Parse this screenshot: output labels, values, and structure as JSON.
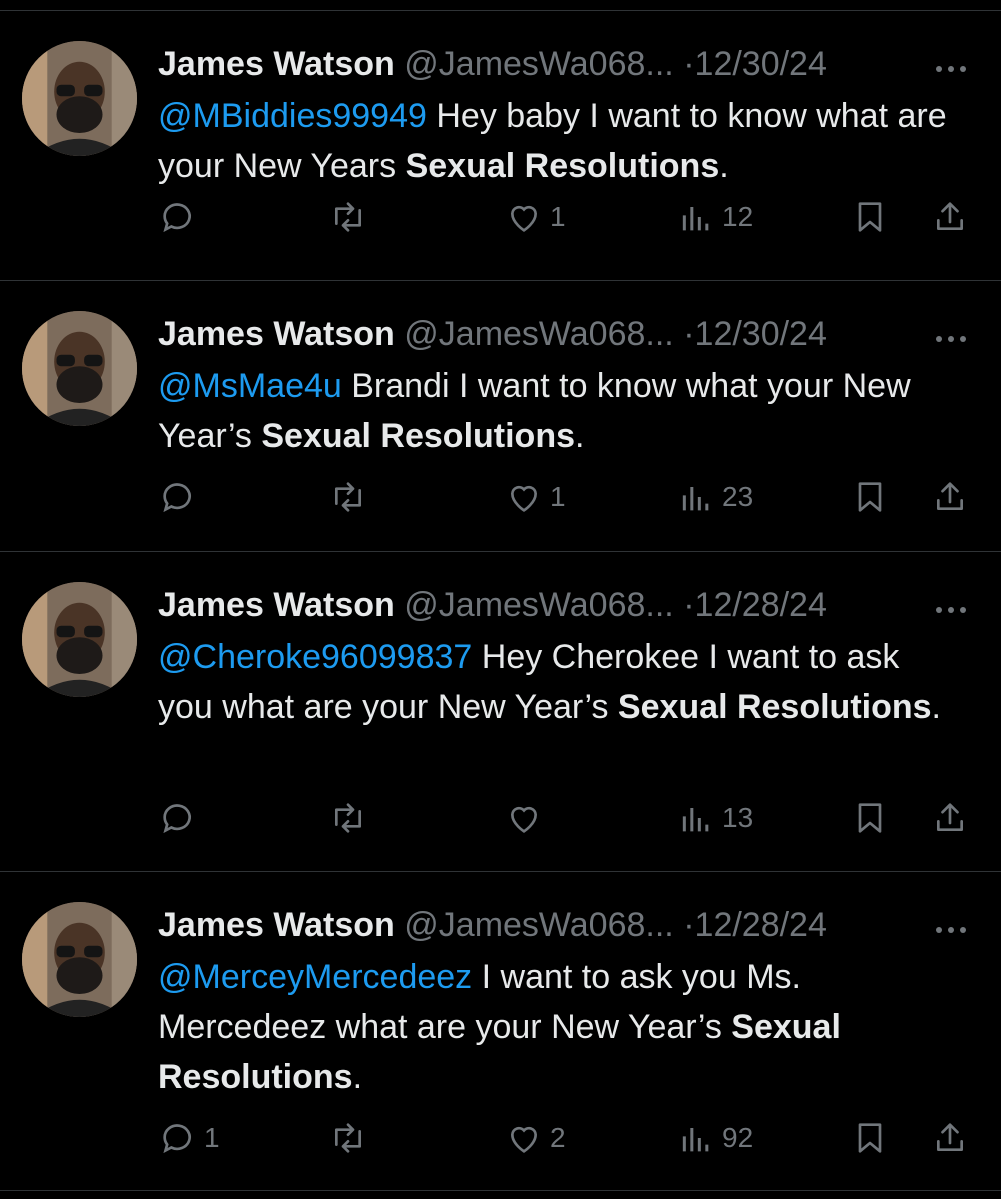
{
  "tweets": [
    {
      "name": "James Watson",
      "handle": "@JamesWa068...",
      "date": "12/30/24",
      "mention": "@MBiddies99949",
      "text_before_bold": " Hey baby I want to know what are your New Years ",
      "bold": "Sexual Resolutions",
      "text_after_bold": ".",
      "replies": "",
      "retweets": "",
      "likes": "1",
      "views": "12"
    },
    {
      "name": "James Watson",
      "handle": "@JamesWa068...",
      "date": "12/30/24",
      "mention": "@MsMae4u",
      "text_before_bold": " Brandi I want to know what your New Year’s ",
      "bold": "Sexual Resolutions",
      "text_after_bold": ".",
      "replies": "",
      "retweets": "",
      "likes": "1",
      "views": "23"
    },
    {
      "name": "James Watson",
      "handle": "@JamesWa068...",
      "date": "12/28/24",
      "mention": "@Cheroke96099837",
      "text_before_bold": " Hey Cherokee I want to ask you what are your New Year’s ",
      "bold": "Sexual Resolutions",
      "text_after_bold": ".",
      "replies": "",
      "retweets": "",
      "likes": "",
      "views": "13"
    },
    {
      "name": "James Watson",
      "handle": "@JamesWa068...",
      "date": "12/28/24",
      "mention": "@MerceyMercedeez",
      "text_before_bold": " I want to ask you Ms. Mercedeez what are your New Year’s ",
      "bold": "Sexual Resolutions",
      "text_after_bold": ".",
      "replies": "1",
      "retweets": "",
      "likes": "2",
      "views": "92"
    }
  ],
  "icons": {
    "reply": "reply-icon",
    "retweet": "retweet-icon",
    "like": "heart-icon",
    "views": "views-icon",
    "bookmark": "bookmark-icon",
    "share": "share-icon",
    "more": "more-icon"
  },
  "colors": {
    "background": "#000000",
    "text": "#e7e9ea",
    "muted": "#71767b",
    "link": "#1d9bf0",
    "divider": "#2f3336"
  }
}
